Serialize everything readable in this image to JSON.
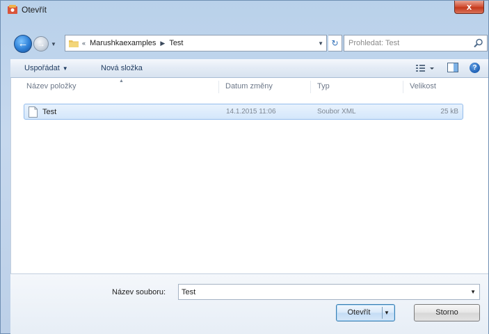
{
  "window": {
    "title": "Otevřít",
    "close_label": "x"
  },
  "navigation": {
    "back_icon": "arrow-left-icon",
    "forward_icon": "arrow-right-icon",
    "crumb_prefix": "«",
    "breadcrumbs": [
      "Marushkaexamples",
      "Test"
    ],
    "search_placeholder": "Prohledat: Test"
  },
  "toolbar": {
    "organize_label": "Uspořádat",
    "new_folder_label": "Nová složka",
    "help_label": "?"
  },
  "file_list": {
    "columns": [
      "Název položky",
      "Datum změny",
      "Typ",
      "Velikost"
    ],
    "rows": [
      {
        "name": "Test",
        "date": "14.1.2015 11:06",
        "type": "Soubor XML",
        "size": "25 kB"
      }
    ]
  },
  "bottom": {
    "filename_label": "Název souboru:",
    "filename_value": "Test",
    "open_label": "Otevřít",
    "cancel_label": "Storno"
  },
  "colors": {
    "accent": "#3c7fb1",
    "selection": "#d4e7fb",
    "close": "#c4391c"
  }
}
